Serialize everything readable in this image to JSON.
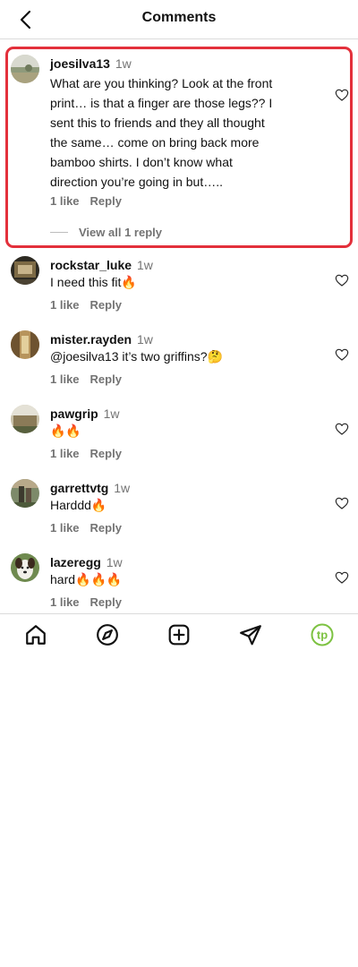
{
  "header": {
    "title": "Comments",
    "back_icon": "chevron-left-icon"
  },
  "comments": [
    {
      "username": "joesilva13",
      "time": "1w",
      "lines": [
        "What are you thinking? Look at the front",
        "print… is that a finger are those legs?? I",
        "sent this to friends and they all thought",
        "the same… come on bring back more",
        "bamboo shirts. I don’t know what",
        "direction you’re going in but….."
      ],
      "likes": "1 like",
      "reply": "Reply",
      "view_replies": "View all 1 reply",
      "highlighted": true
    },
    {
      "username": "rockstar_luke",
      "time": "1w",
      "lines": [
        "I need this fit🔥"
      ],
      "likes": "1 like",
      "reply": "Reply"
    },
    {
      "username": "mister.rayden",
      "time": "1w",
      "lines": [
        "@joesilva13 it’s two griffins?🤔"
      ],
      "likes": "1 like",
      "reply": "Reply"
    },
    {
      "username": "pawgrip",
      "time": "1w",
      "lines": [
        "🔥🔥"
      ],
      "likes": "1 like",
      "reply": "Reply"
    },
    {
      "username": "garrettvtg",
      "time": "1w",
      "lines": [
        "Harddd🔥"
      ],
      "likes": "1 like",
      "reply": "Reply"
    },
    {
      "username": "lazeregg",
      "time": "1w",
      "lines": [
        "hard🔥🔥🔥"
      ],
      "likes": "1 like",
      "reply": "Reply"
    }
  ],
  "nav": {
    "items": [
      "home-icon",
      "explore-icon",
      "create-icon",
      "send-icon",
      "profile-avatar-icon"
    ],
    "profile_initials": "tp",
    "profile_color": "#7dc242"
  },
  "colors": {
    "highlight": "#e3303b",
    "muted": "#737373"
  }
}
